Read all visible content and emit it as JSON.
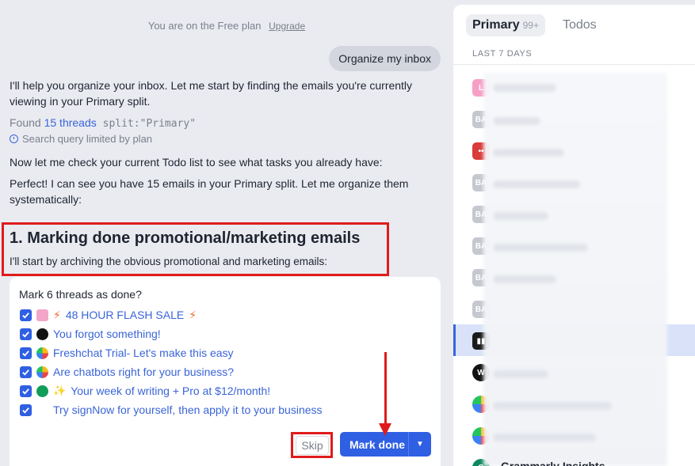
{
  "chat": {
    "plan_text": "You are on the Free plan",
    "upgrade_label": "Upgrade",
    "user_message": "Organize my inbox",
    "msg1": "I'll help you organize your inbox. Let me start by finding the emails you're currently viewing in your Primary split.",
    "found_prefix": "Found",
    "found_link": "15 threads",
    "found_query": "split:\"Primary\"",
    "limited_text": "Search query limited by plan",
    "msg2": "Now let me check your current Todo list to see what tasks you already have:",
    "msg3": "Perfect! I can see you have 15 emails in your Primary split. Let me organize them systematically:",
    "section_title": "1. Marking done promotional/marketing emails",
    "section_sub": "I'll start by archiving the obvious promotional and marketing emails:",
    "card": {
      "title": "Mark 6 threads as done?",
      "threads": [
        {
          "icon": "L",
          "prefix": "⚡",
          "text": "48 HOUR FLASH SALE",
          "suffix": "⚡"
        },
        {
          "icon": "M",
          "prefix": "",
          "text": "You forgot something!",
          "suffix": ""
        },
        {
          "icon": "F",
          "prefix": "",
          "text": "Freshchat Trial- Let's make this easy",
          "suffix": ""
        },
        {
          "icon": "F",
          "prefix": "",
          "text": "Are chatbots right for your business?",
          "suffix": ""
        },
        {
          "icon": "G",
          "prefix": "✨",
          "text": "Your week of writing + Pro at $12/month!",
          "suffix": ""
        },
        {
          "icon": "S",
          "prefix": "",
          "text": "Try signNow for yourself, then apply it to your business",
          "suffix": ""
        }
      ],
      "skip_label": "Skip",
      "mark_done_label": "Mark done"
    }
  },
  "inbox": {
    "tab_primary": "Primary",
    "tab_primary_count": "99+",
    "tab_todos": "Todos",
    "section_label": "LAST 7 DAYS",
    "avatars": [
      "L",
      "BA",
      "••",
      "BA",
      "BA",
      "BA",
      "BA",
      "BA",
      "▮▮",
      "W",
      "",
      "",
      "G"
    ],
    "bottom_sender": "Grammarly Insights"
  },
  "colors": {
    "accent": "#2f5fe3",
    "annotation_red": "#e01b1b",
    "link": "#3a64d8"
  }
}
